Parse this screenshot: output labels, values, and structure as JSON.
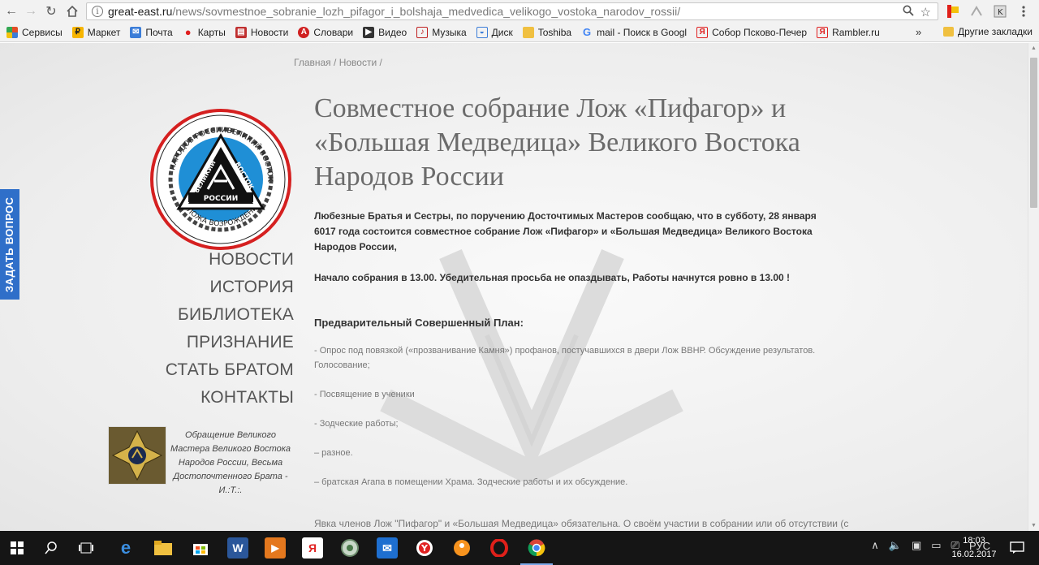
{
  "browser": {
    "url_host": "great-east.ru",
    "url_path": "/news/sovmestnoe_sobranie_lozh_pifagor_i_bolshaja_medvedica_velikogo_vostoka_narodov_rossii/",
    "info_glyph": "i",
    "bookmarks": [
      {
        "label": "Сервисы",
        "icon": "apps-grid-icon",
        "color": "#e44d26"
      },
      {
        "label": "Маркет",
        "icon": "market-icon",
        "color": "#f7b500"
      },
      {
        "label": "Почта",
        "icon": "mail-icon",
        "color": "#3b7dd8"
      },
      {
        "label": "Карты",
        "icon": "map-pin-icon",
        "color": "#e02020"
      },
      {
        "label": "Новости",
        "icon": "news-icon",
        "color": "#c03030"
      },
      {
        "label": "Словари",
        "icon": "dictionary-icon",
        "color": "#d02020"
      },
      {
        "label": "Видео",
        "icon": "video-icon",
        "color": "#333333"
      },
      {
        "label": "Музыка",
        "icon": "music-icon",
        "color": "#c02020"
      },
      {
        "label": "Диск",
        "icon": "disk-icon",
        "color": "#3b7dd8"
      },
      {
        "label": "Toshiba",
        "icon": "folder-icon",
        "color": "#f0c040"
      },
      {
        "label": "mail - Поиск в Googl",
        "icon": "google-icon",
        "color": "#4285f4"
      },
      {
        "label": "Собор Псково-Печер",
        "icon": "yandex-icon",
        "color": "#e02020"
      },
      {
        "label": "Rambler.ru",
        "icon": "yandex-icon",
        "color": "#e02020"
      }
    ],
    "more_label": "»",
    "other_bookmarks": "Другие закладки"
  },
  "page": {
    "ask_tab": "ЗАДАТЬ ВОПРОС",
    "breadcrumb": {
      "home": "Главная",
      "sep": "/",
      "news": "Новости",
      "sep2": "/"
    },
    "menu": [
      "НОВОСТИ",
      "ИСТОРИЯ",
      "БИБЛИОТЕКА",
      "ПРИЗНАНИЕ",
      "СТАТЬ БРАТОМ",
      "КОНТАКТЫ"
    ],
    "notice_text": "Обращение Великого Мастера Великого Востока Народов России, Весьма Достопочтенного Брата - И.:Т.:.",
    "logo": {
      "top_left": "НАРОДОВ РОССИИ",
      "top_right": "ВЕЛИКИЙ ВОСТОК",
      "bottom": "ЛОЖА ВОЗРОЖДЕНИЕ",
      "tri_left": "ВЕЛИКИЙ",
      "tri_right": "ВОСТОК",
      "band": "РОССИИ"
    },
    "article": {
      "title": "Совместное собрание Лож «Пифагор» и «Большая Медведица» Великого Востока Народов России",
      "intro": "Любезные Братья и Сестры, по поручению Досточтимых Мастеров сообщаю, что в субботу, 28 января 6017 года состоится совместное собрание Лож «Пифагор» и «Большая Медведица» Великого Востока Народов России,",
      "start": "Начало собрания в 13.00. Убедительная просьба не опаздывать, Работы начнутся ровно в 13.00 !",
      "plan_heading": "Предварительный Совершенный План:",
      "plan_items": [
        "- Опрос под повязкой («прозванивание Камня») профанов, постучавшихся в двери Лож ВВНР. Обсуждение результатов. Голосование;",
        "-  Посвящение в ученики",
        "- Зодческие работы;",
        "– разное.",
        "– братская Агапа в помещении Храма. Зодческие работы и их обсуждение."
      ],
      "footer": "Явка членов  Лож \"Пифагор\" и «Большая Медведица» обязательна. О своём участии в собрании или об отсутствии (с"
    }
  },
  "taskbar": {
    "lang": "РУС",
    "time": "18:03",
    "date": "16.02.2017"
  }
}
